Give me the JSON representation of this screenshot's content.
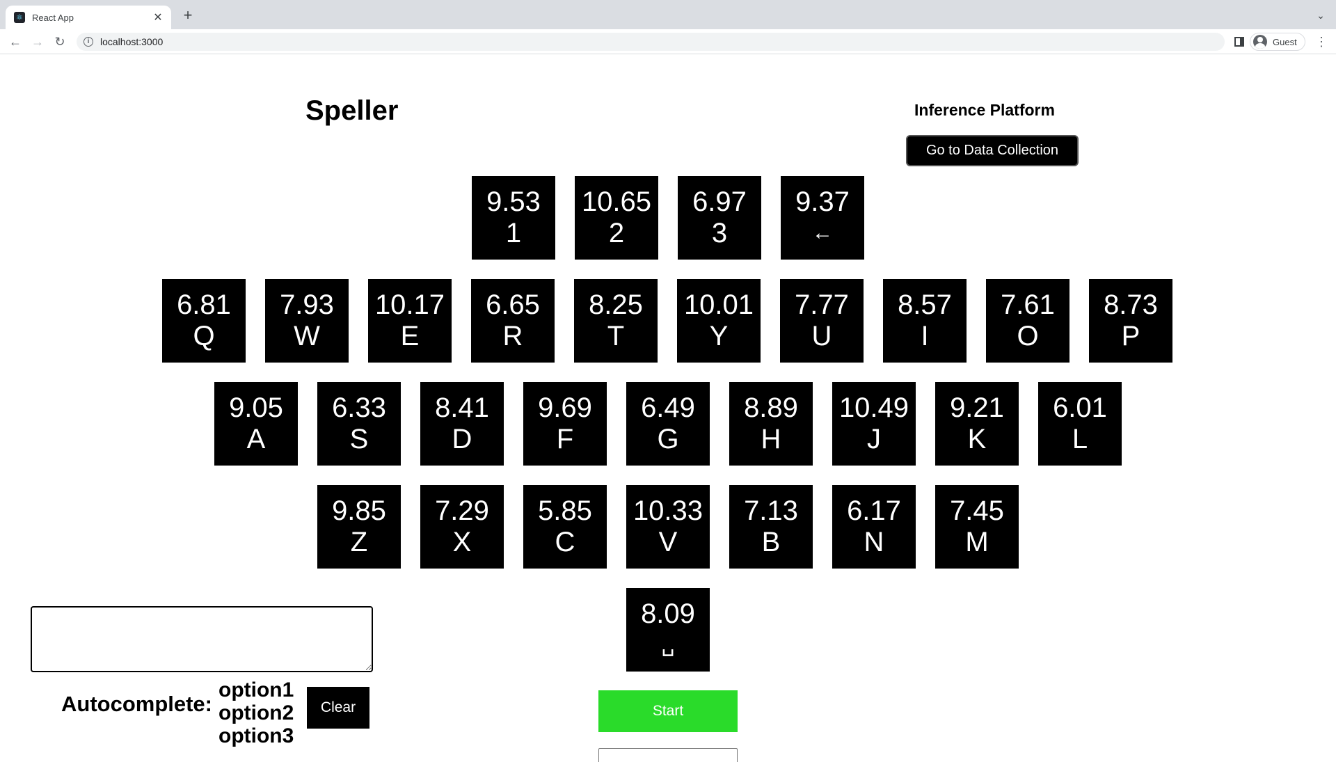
{
  "browser": {
    "tab_title": "React App",
    "tab_favicon": "react-logo-icon",
    "new_tab_label": "+",
    "url": "localhost:3000",
    "profile_name": "Guest"
  },
  "header": {
    "title": "Speller",
    "platform_label": "Inference Platform",
    "go_button_label": "Go to Data Collection"
  },
  "keyboard": {
    "rows": [
      [
        {
          "label": "1",
          "score": "9.53"
        },
        {
          "label": "2",
          "score": "10.65"
        },
        {
          "label": "3",
          "score": "6.97"
        },
        {
          "label": "←",
          "score": "9.37"
        }
      ],
      [
        {
          "label": "Q",
          "score": "6.81"
        },
        {
          "label": "W",
          "score": "7.93"
        },
        {
          "label": "E",
          "score": "10.17"
        },
        {
          "label": "R",
          "score": "6.65"
        },
        {
          "label": "T",
          "score": "8.25"
        },
        {
          "label": "Y",
          "score": "10.01"
        },
        {
          "label": "U",
          "score": "7.77"
        },
        {
          "label": "I",
          "score": "8.57"
        },
        {
          "label": "O",
          "score": "7.61"
        },
        {
          "label": "P",
          "score": "8.73"
        }
      ],
      [
        {
          "label": "A",
          "score": "9.05"
        },
        {
          "label": "S",
          "score": "6.33"
        },
        {
          "label": "D",
          "score": "8.41"
        },
        {
          "label": "F",
          "score": "9.69"
        },
        {
          "label": "G",
          "score": "6.49"
        },
        {
          "label": "H",
          "score": "8.89"
        },
        {
          "label": "J",
          "score": "10.49"
        },
        {
          "label": "K",
          "score": "9.21"
        },
        {
          "label": "L",
          "score": "6.01"
        }
      ],
      [
        {
          "label": "Z",
          "score": "9.85"
        },
        {
          "label": "X",
          "score": "7.29"
        },
        {
          "label": "C",
          "score": "5.85"
        },
        {
          "label": "V",
          "score": "10.33"
        },
        {
          "label": "B",
          "score": "7.13"
        },
        {
          "label": "N",
          "score": "6.17"
        },
        {
          "label": "M",
          "score": "7.45"
        }
      ],
      [
        {
          "label": "␣",
          "score": "8.09"
        }
      ]
    ]
  },
  "text_output": {
    "value": "",
    "placeholder": ""
  },
  "autocomplete": {
    "label": "Autocomplete:",
    "options": [
      "option1",
      "option2",
      "option3"
    ],
    "clear_label": "Clear"
  },
  "controls": {
    "start_label": "Start"
  }
}
